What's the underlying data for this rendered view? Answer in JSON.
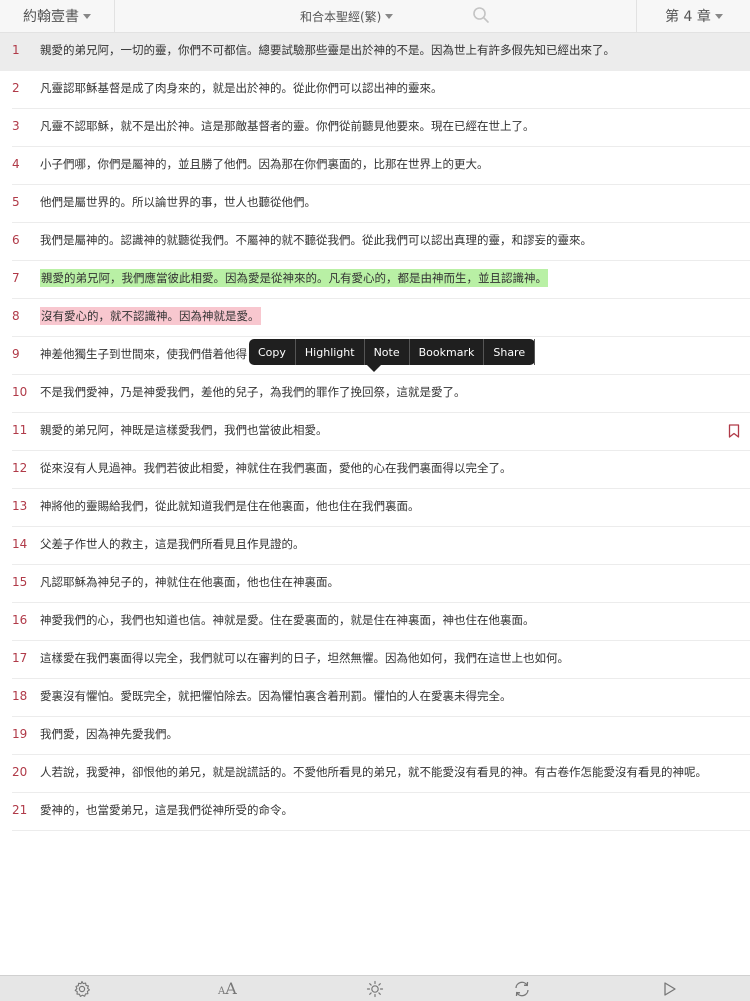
{
  "header": {
    "book": "約翰壹書",
    "version": "和合本聖經(繁)",
    "chapter": "第 4 章"
  },
  "verses": [
    {
      "num": "1",
      "text": "親愛的弟兄阿，一切的靈，你們不可都信。總要試驗那些靈是出於神的不是。因為世上有許多假先知已經出來了。"
    },
    {
      "num": "2",
      "text": "凡靈認耶穌基督是成了肉身來的，就是出於神的。從此你們可以認出神的靈來。"
    },
    {
      "num": "3",
      "text": "凡靈不認耶穌，就不是出於神。這是那敵基督者的靈。你們從前聽見他要來。現在已經在世上了。"
    },
    {
      "num": "4",
      "text": "小子們哪，你們是屬神的，並且勝了他們。因為那在你們裏面的，比那在世界上的更大。"
    },
    {
      "num": "5",
      "text": "他們是屬世界的。所以論世界的事，世人也聽從他們。"
    },
    {
      "num": "6",
      "text": "我們是屬神的。認識神的就聽從我們。不屬神的就不聽從我們。從此我們可以認出真理的靈，和謬妄的靈來。"
    },
    {
      "num": "7",
      "text": "親愛的弟兄阿，我們應當彼此相愛。因為愛是從神來的。凡有愛心的，都是由神而生，並且認識神。"
    },
    {
      "num": "8",
      "text": "沒有愛心的，就不認識神。因為神就是愛。"
    },
    {
      "num": "9",
      "text": "神差他獨生子到世間來，使我們借着他得"
    },
    {
      "num": "10",
      "text": "不是我們愛神，乃是神愛我們，差他的兒子，為我們的罪作了挽回祭，這就是愛了。"
    },
    {
      "num": "11",
      "text": "親愛的弟兄阿，神既是這樣愛我們，我們也當彼此相愛。"
    },
    {
      "num": "12",
      "text": "從來沒有人見過神。我們若彼此相愛，神就住在我們裏面，愛他的心在我們裏面得以完全了。"
    },
    {
      "num": "13",
      "text": "神將他的靈賜給我們，從此就知道我們是住在他裏面，他也住在我們裏面。"
    },
    {
      "num": "14",
      "text": "父差子作世人的救主，這是我們所看見且作見證的。"
    },
    {
      "num": "15",
      "text": "凡認耶穌為神兒子的，神就住在他裏面，他也住在神裏面。"
    },
    {
      "num": "16",
      "text": "神愛我們的心，我們也知道也信。神就是愛。住在愛裏面的，就是住在神裏面，神也住在他裏面。"
    },
    {
      "num": "17",
      "text": "這樣愛在我們裏面得以完全，我們就可以在審判的日子，坦然無懼。因為他如何，我們在這世上也如何。"
    },
    {
      "num": "18",
      "text": "愛裏沒有懼怕。愛既完全，就把懼怕除去。因為懼怕裏含着刑罰。懼怕的人在愛裏未得完全。"
    },
    {
      "num": "19",
      "text": "我們愛，因為神先愛我們。"
    },
    {
      "num": "20",
      "text": "人若說，我愛神，卻恨他的弟兄，就是說謊話的。不愛他所看見的弟兄，就不能愛沒有看見的神。有古卷作怎能愛沒有看見的神呢。"
    },
    {
      "num": "21",
      "text": "愛神的，也當愛弟兄，這是我們從神所受的命令。"
    }
  ],
  "popup": {
    "copy": "Copy",
    "highlight": "Highlight",
    "note": "Note",
    "bookmark": "Bookmark",
    "share": "Share"
  },
  "footer": {
    "font_small": "A",
    "font_big": "A"
  },
  "colors": {
    "verse_number": "#b03a48",
    "highlight_green": "#b9f0a5",
    "highlight_pink": "#f8c7cf",
    "bookmark": "#b03a48"
  },
  "icons": [
    "search-icon",
    "bookmark-icon",
    "settings-icon",
    "brightness-icon",
    "sync-icon",
    "play-icon"
  ]
}
